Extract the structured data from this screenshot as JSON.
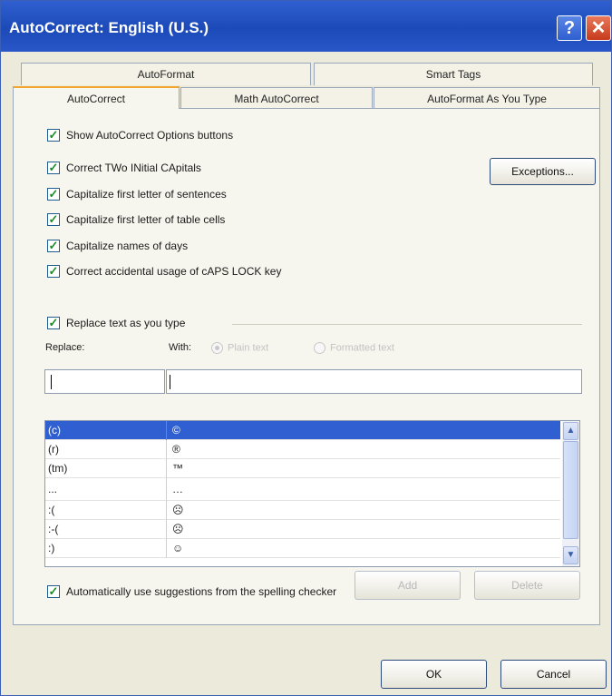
{
  "window": {
    "title": "AutoCorrect: English (U.S.)",
    "help_glyph": "?",
    "close_glyph": "✕"
  },
  "tabs": {
    "row1": [
      "AutoFormat",
      "Smart Tags"
    ],
    "row2": [
      "AutoCorrect",
      "Math AutoCorrect",
      "AutoFormat As You Type"
    ],
    "active": "AutoCorrect"
  },
  "options": {
    "show_buttons": {
      "label": "Show AutoCorrect Options buttons",
      "checked": true
    },
    "correct_two_initial": {
      "label": "Correct TWo INitial CApitals",
      "checked": true
    },
    "capitalize_sentences": {
      "label": "Capitalize first letter of sentences",
      "checked": true
    },
    "capitalize_table_cells": {
      "label": "Capitalize first letter of table cells",
      "checked": true
    },
    "capitalize_days": {
      "label": "Capitalize names of days",
      "checked": true
    },
    "caps_lock": {
      "label": "Correct accidental usage of cAPS LOCK key",
      "checked": true
    },
    "replace_text": {
      "label": "Replace text as you type",
      "checked": true
    },
    "auto_suggestions": {
      "label": "Automatically use suggestions from the spelling checker",
      "checked": true
    }
  },
  "exceptions_button": "Exceptions...",
  "replace": {
    "replace_label": "Replace:",
    "with_label": "With:",
    "plain_text": "Plain text",
    "formatted_text": "Formatted text",
    "replace_value": "",
    "with_value": ""
  },
  "entries": [
    {
      "replace": "(c)",
      "with": "©"
    },
    {
      "replace": "(r)",
      "with": "®"
    },
    {
      "replace": "(tm)",
      "with": "™"
    },
    {
      "replace": "...",
      "with": "…"
    },
    {
      "replace": ":(",
      "with": "☹"
    },
    {
      "replace": ":-(",
      "with": "☹"
    },
    {
      "replace": ":)",
      "with": "☺"
    }
  ],
  "scroll": {
    "up": "▲",
    "down": "▼"
  },
  "check_glyph": "✓",
  "buttons": {
    "add": "Add",
    "delete": "Delete",
    "ok": "OK",
    "cancel": "Cancel"
  }
}
